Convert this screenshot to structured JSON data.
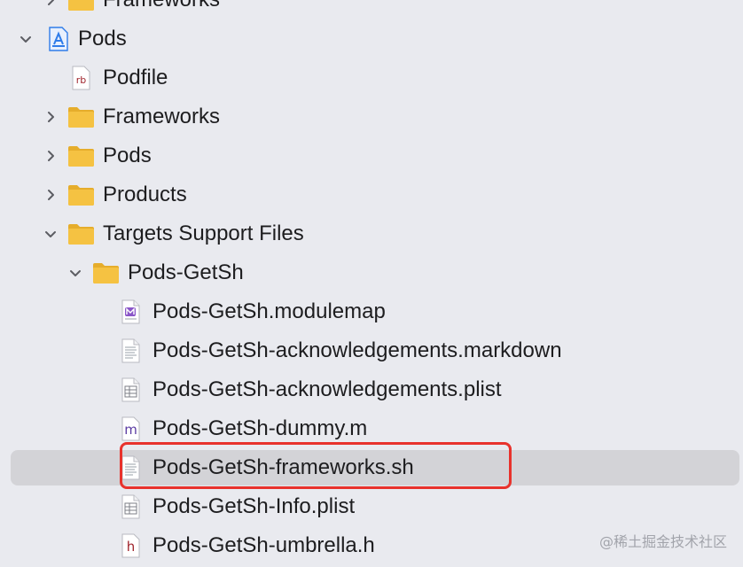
{
  "navigator": {
    "rows": [
      {
        "name": "Frameworks",
        "icon": "folder-icon",
        "disclosure": "collapsed"
      },
      {
        "name": "Pods",
        "icon": "xcode-project-icon",
        "disclosure": "expanded"
      },
      {
        "name": "Podfile",
        "icon": "ruby-file-icon",
        "badge": "rb",
        "disclosure": "none"
      },
      {
        "name": "Frameworks",
        "icon": "folder-icon",
        "disclosure": "collapsed"
      },
      {
        "name": "Pods",
        "icon": "folder-icon",
        "disclosure": "collapsed"
      },
      {
        "name": "Products",
        "icon": "folder-icon",
        "disclosure": "collapsed"
      },
      {
        "name": "Targets Support Files",
        "icon": "folder-icon",
        "disclosure": "expanded"
      },
      {
        "name": "Pods-GetSh",
        "icon": "folder-icon",
        "disclosure": "expanded"
      },
      {
        "name": "Pods-GetSh.modulemap",
        "icon": "modulemap-file-icon",
        "disclosure": "none"
      },
      {
        "name": "Pods-GetSh-acknowledgements.markdown",
        "icon": "text-document-icon",
        "disclosure": "none"
      },
      {
        "name": "Pods-GetSh-acknowledgements.plist",
        "icon": "plist-file-icon",
        "disclosure": "none"
      },
      {
        "name": "Pods-GetSh-dummy.m",
        "icon": "objc-source-icon",
        "badge": "m",
        "disclosure": "none"
      },
      {
        "name": "Pods-GetSh-frameworks.sh",
        "icon": "shell-script-icon",
        "disclosure": "none",
        "selected": true
      },
      {
        "name": "Pods-GetSh-Info.plist",
        "icon": "plist-file-icon",
        "disclosure": "none"
      },
      {
        "name": "Pods-GetSh-umbrella.h",
        "icon": "header-file-icon",
        "badge": "h",
        "disclosure": "none"
      }
    ]
  },
  "colors": {
    "background": "#e9eaef",
    "selection": "#d3d3d7",
    "highlight_border": "#e8322c",
    "folder": "#f5c242",
    "project_icon": "#2f7ce9"
  },
  "watermark": "@稀土掘金技术社区"
}
